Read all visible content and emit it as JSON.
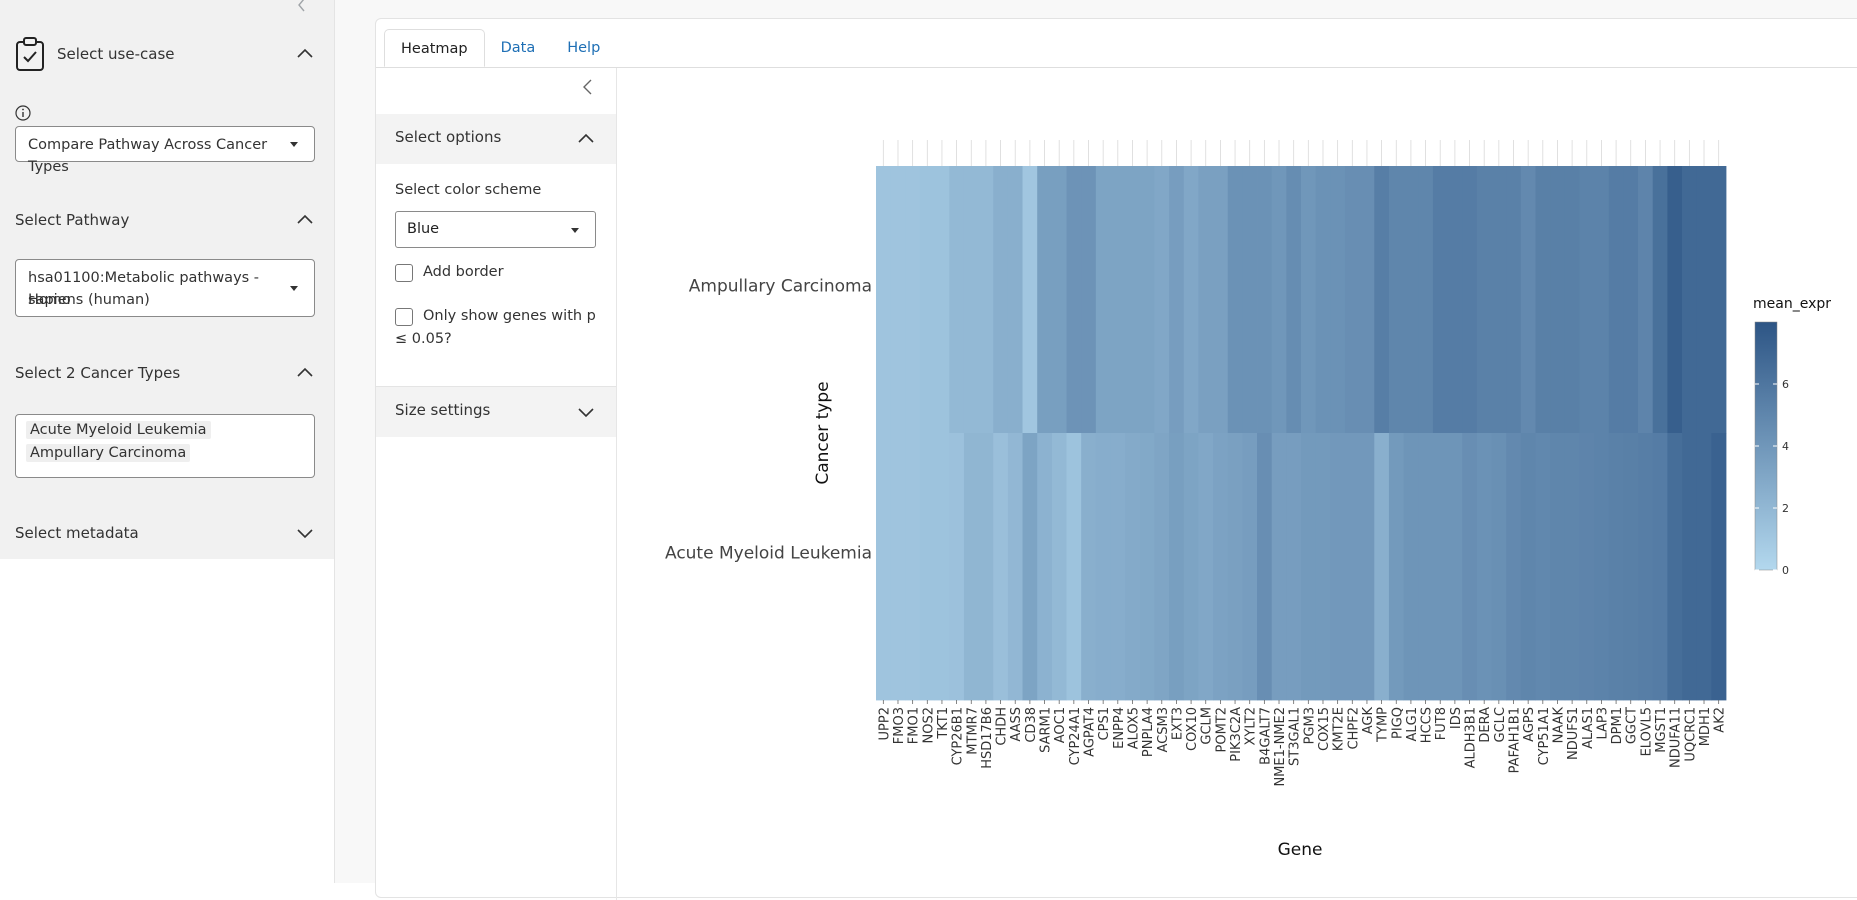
{
  "sidebar": {
    "use_case": {
      "header": "Select use-case",
      "value": "Compare Pathway Across Cancer Types"
    },
    "pathway": {
      "header": "Select Pathway",
      "value_line1": "hsa01100:Metabolic pathways - Homo",
      "value_line2": "sapiens (human)"
    },
    "cancer_types": {
      "header": "Select 2 Cancer Types",
      "chips": [
        "Acute Myeloid Leukemia",
        "Ampullary Carcinoma"
      ]
    },
    "metadata": {
      "header": "Select metadata"
    }
  },
  "tabs": [
    {
      "label": "Heatmap",
      "active": true
    },
    {
      "label": "Data",
      "active": false
    },
    {
      "label": "Help",
      "active": false
    }
  ],
  "options": {
    "select_options_header": "Select options",
    "color_scheme_label": "Select color scheme",
    "color_scheme_value": "Blue",
    "add_border_label": "Add border",
    "add_border_checked": false,
    "pvalue_label_line1": "Only show genes with p",
    "pvalue_label_line2": "≤ 0.05?",
    "pvalue_checked": false,
    "size_settings_header": "Size settings"
  },
  "colors": {
    "low": "#b3d8ee",
    "high": "#2d5585",
    "link": "#1e6fb5"
  },
  "chart_data": {
    "type": "heatmap",
    "xlabel": "Gene",
    "ylabel": "Cancer type",
    "legend_title": "mean_expr",
    "legend_ticks": [
      0,
      2,
      4,
      6
    ],
    "value_range": [
      0,
      8
    ],
    "rows": [
      "Ampullary Carcinoma",
      "Acute Myeloid Leukemia"
    ],
    "genes": [
      "UPP2",
      "FMO3",
      "FMO1",
      "NOS2",
      "TKT1",
      "CYP26B1",
      "MTMR7",
      "HSD17B6",
      "CHDH",
      "AASS",
      "CD38",
      "SARM1",
      "AOC1",
      "CYP24A1",
      "AGPAT4",
      "CPS1",
      "ENPP4",
      "ALOX5",
      "PNPLA4",
      "ACSM3",
      "EXT3",
      "COX10",
      "GCLM",
      "POMT2",
      "PIK3C2A",
      "XYLT2",
      "B4GALT7",
      "NME1-NME2",
      "ST3GAL1",
      "PGM3",
      "COX15",
      "KMT2E",
      "CHPF2",
      "AGK",
      "TYMP",
      "PIGQ",
      "ALG1",
      "HCCS",
      "FUT8",
      "IDS",
      "ALDH3B1",
      "DERA",
      "GCLC",
      "PAFAH1B1",
      "AGPS",
      "CYP51A1",
      "NAAK",
      "NDUFS1",
      "ALAS1",
      "LAP3",
      "DPM1",
      "GGCT",
      "ELOVL5",
      "MGST1",
      "NDUFA11",
      "UQCRC1",
      "MDH1",
      "AK2"
    ],
    "values": [
      [
        1.2,
        1.2,
        1.2,
        1.3,
        1.3,
        1.9,
        1.9,
        1.9,
        2.5,
        2.5,
        1.1,
        3.5,
        3.5,
        4.2,
        4.2,
        3.2,
        3.2,
        3.2,
        3.2,
        3.0,
        3.6,
        3.0,
        3.4,
        3.4,
        4.3,
        4.3,
        4.3,
        4.0,
        4.6,
        4.0,
        4.3,
        4.3,
        4.5,
        4.5,
        5.5,
        5.0,
        5.0,
        5.0,
        5.6,
        5.6,
        5.6,
        5.3,
        5.3,
        5.3,
        4.8,
        5.4,
        5.4,
        5.4,
        5.2,
        5.2,
        5.6,
        5.6,
        5.1,
        6.3,
        7.4,
        6.8,
        6.8,
        6.8
      ],
      [
        1.2,
        1.2,
        1.2,
        1.3,
        1.3,
        1.4,
        2.1,
        2.1,
        1.5,
        2.0,
        3.2,
        2.3,
        1.9,
        1.3,
        2.5,
        2.6,
        2.6,
        2.8,
        2.9,
        3.1,
        3.5,
        3.2,
        3.0,
        3.3,
        3.4,
        3.6,
        4.5,
        3.6,
        3.6,
        3.8,
        3.8,
        3.9,
        3.9,
        3.9,
        2.5,
        3.8,
        4.1,
        4.1,
        4.1,
        4.1,
        4.5,
        4.3,
        4.4,
        4.8,
        5.0,
        4.9,
        5.0,
        5.0,
        5.1,
        5.2,
        5.3,
        5.4,
        5.5,
        5.6,
        6.5,
        6.8,
        6.8,
        7.2
      ]
    ]
  }
}
